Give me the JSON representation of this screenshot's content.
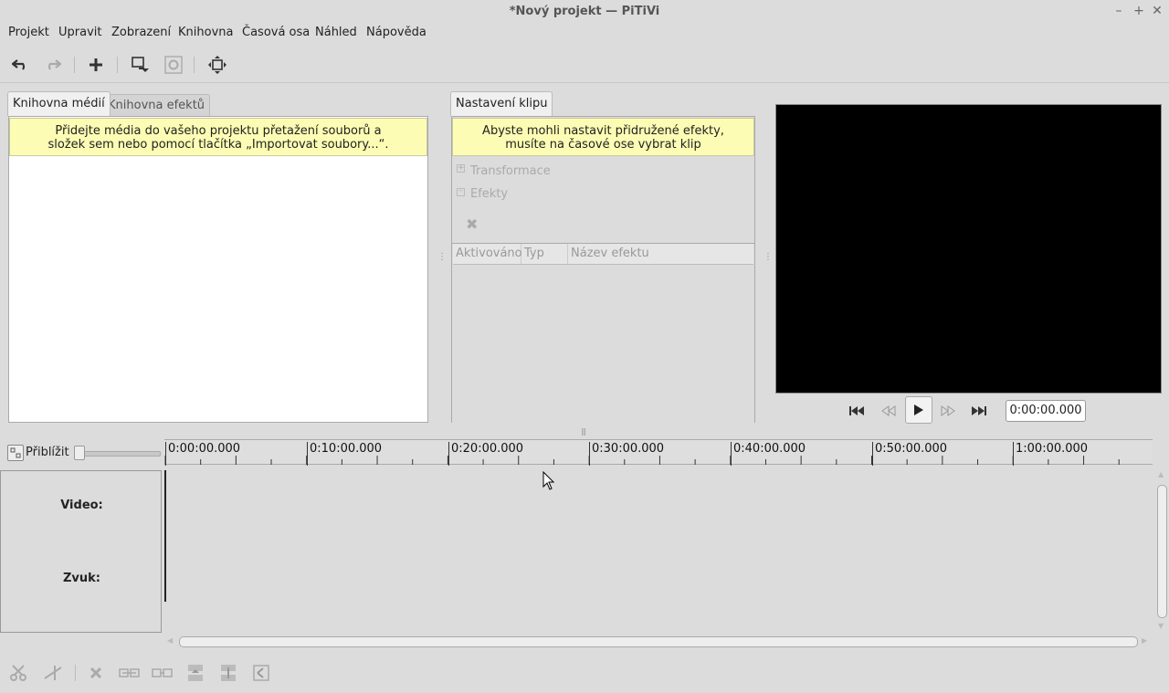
{
  "window": {
    "title": "*Nový projekt — PiTiVi"
  },
  "menu": {
    "projekt": "Projekt",
    "upravit": "Upravit",
    "zobrazeni": "Zobrazení",
    "knihovna": "Knihovna",
    "casova_osa": "Časová osa",
    "nahled": "Náhled",
    "napoveda": "Nápověda"
  },
  "media_library": {
    "tab_media": "Knihovna médií",
    "tab_effects": "Knihovna efektů",
    "info_line1": "Přidejte média do vašeho projektu přetažení souborů a",
    "info_line2": "složek sem nebo pomocí tlačítka „Importovat soubory...“."
  },
  "clip_settings": {
    "tab": "Nastavení klipu",
    "info_line1": "Abyste mohli nastavit přidružené efekty,",
    "info_line2": "musíte na časové ose vybrat klip",
    "transformace": "Transformace",
    "efekty": "Efekty",
    "columns": [
      "Aktivováno",
      "Typ",
      "Název efektu"
    ]
  },
  "viewer": {
    "timecode": "0:00:00.000"
  },
  "timeline": {
    "zoom_label": "Přiblížit",
    "ruler_labels": [
      "0:00:00.000",
      "0:10:00.000",
      "0:20:00.000",
      "0:30:00.000",
      "0:40:00.000",
      "0:50:00.000",
      "1:00:00.000"
    ],
    "tracks": {
      "video": "Video:",
      "audio": "Zvuk:"
    }
  }
}
